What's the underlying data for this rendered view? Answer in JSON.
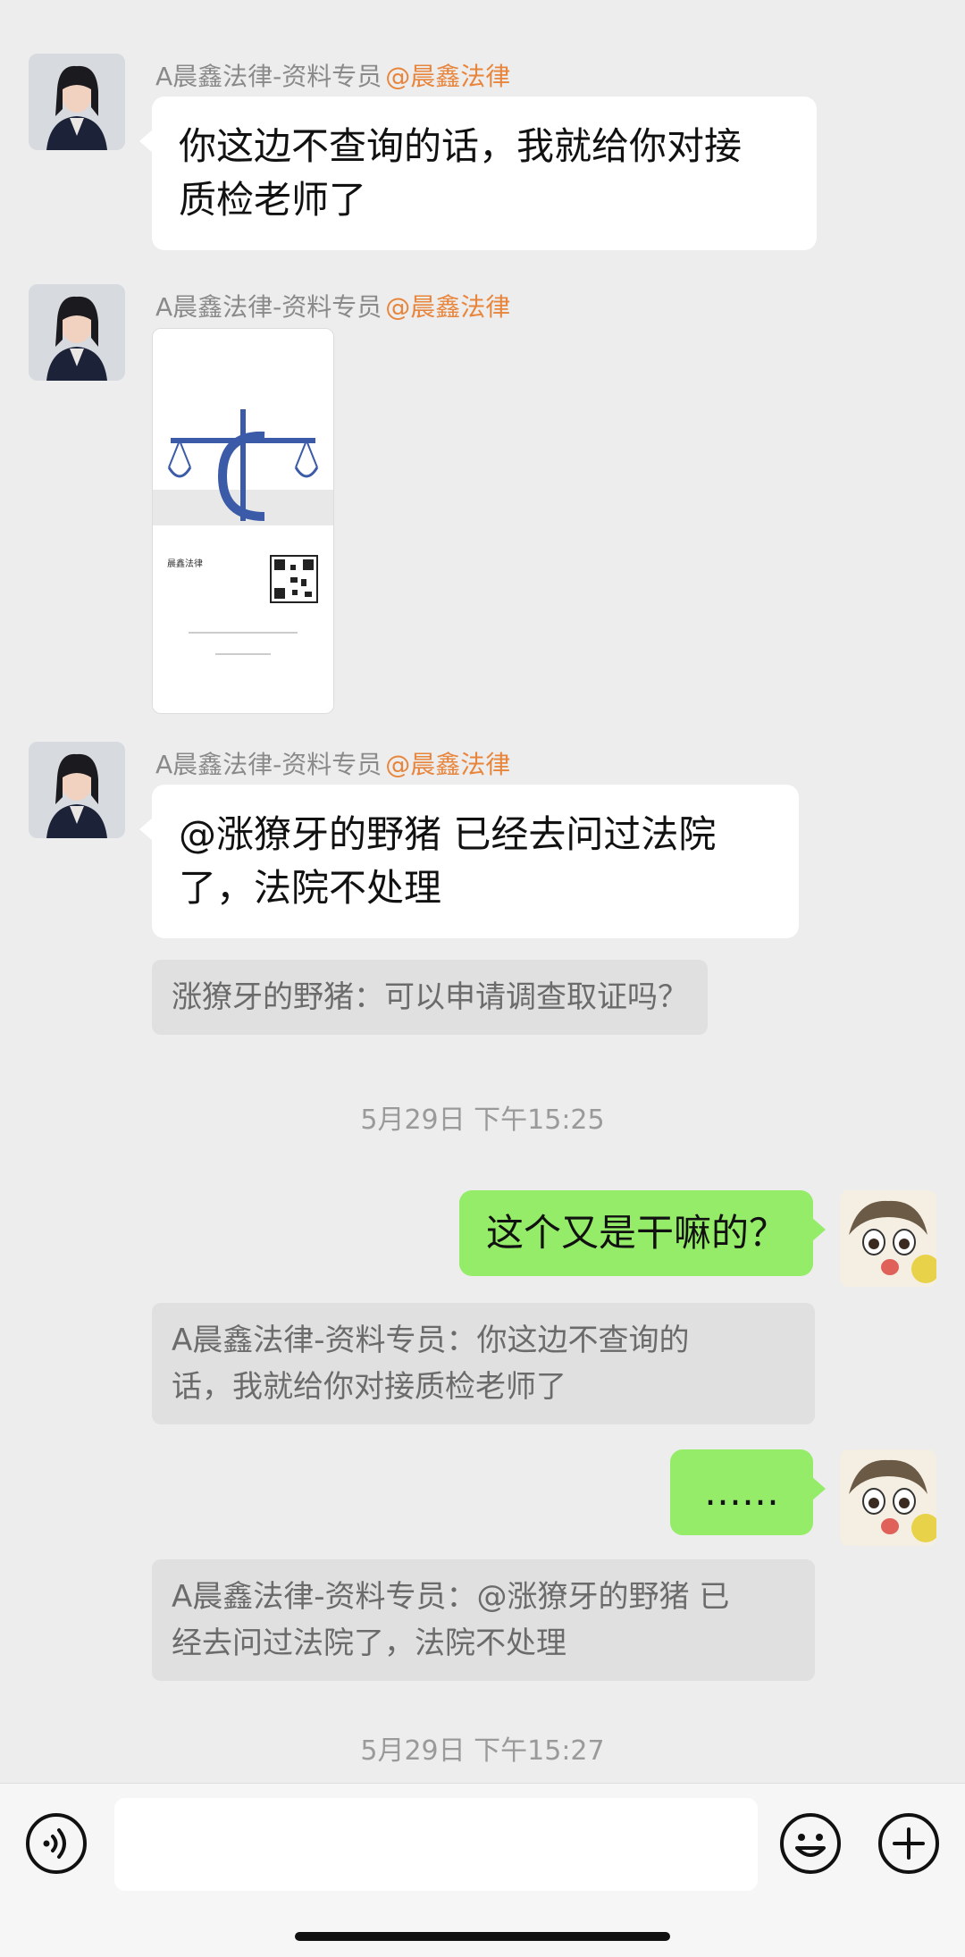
{
  "messages": [
    {
      "sender_name": "A晨鑫法律-资料专员",
      "sender_tag": "@晨鑫法律",
      "text_line1": "你这边不查询的话，我就给你对接",
      "text_line2": "质检老师了"
    },
    {
      "sender_name": "A晨鑫法律-资料专员",
      "sender_tag": "@晨鑫法律",
      "card_brand": "晨鑫法律"
    },
    {
      "sender_name": "A晨鑫法律-资料专员",
      "sender_tag": "@晨鑫法律",
      "text_line1": "@涨獠牙的野猪 已经去问过法院",
      "text_line2": "了，法院不处理",
      "quote": "涨獠牙的野猪：可以申请调查取证吗？"
    }
  ],
  "time1": "5月29日 下午15:25",
  "self_messages": [
    {
      "text": "这个又是干嘛的？",
      "quote_line1": "A晨鑫法律-资料专员：你这边不查询的",
      "quote_line2": "话，我就给你对接质检老师了"
    },
    {
      "text": "……",
      "quote_line1": "A晨鑫法律-资料专员：@涨獠牙的野猪 已",
      "quote_line2": "经去问过法院了，法院不处理"
    }
  ],
  "time2": "5月29日 下午15:27",
  "icons": {
    "voice": "voice-icon",
    "emoji": "emoji-icon",
    "plus": "plus-icon"
  }
}
